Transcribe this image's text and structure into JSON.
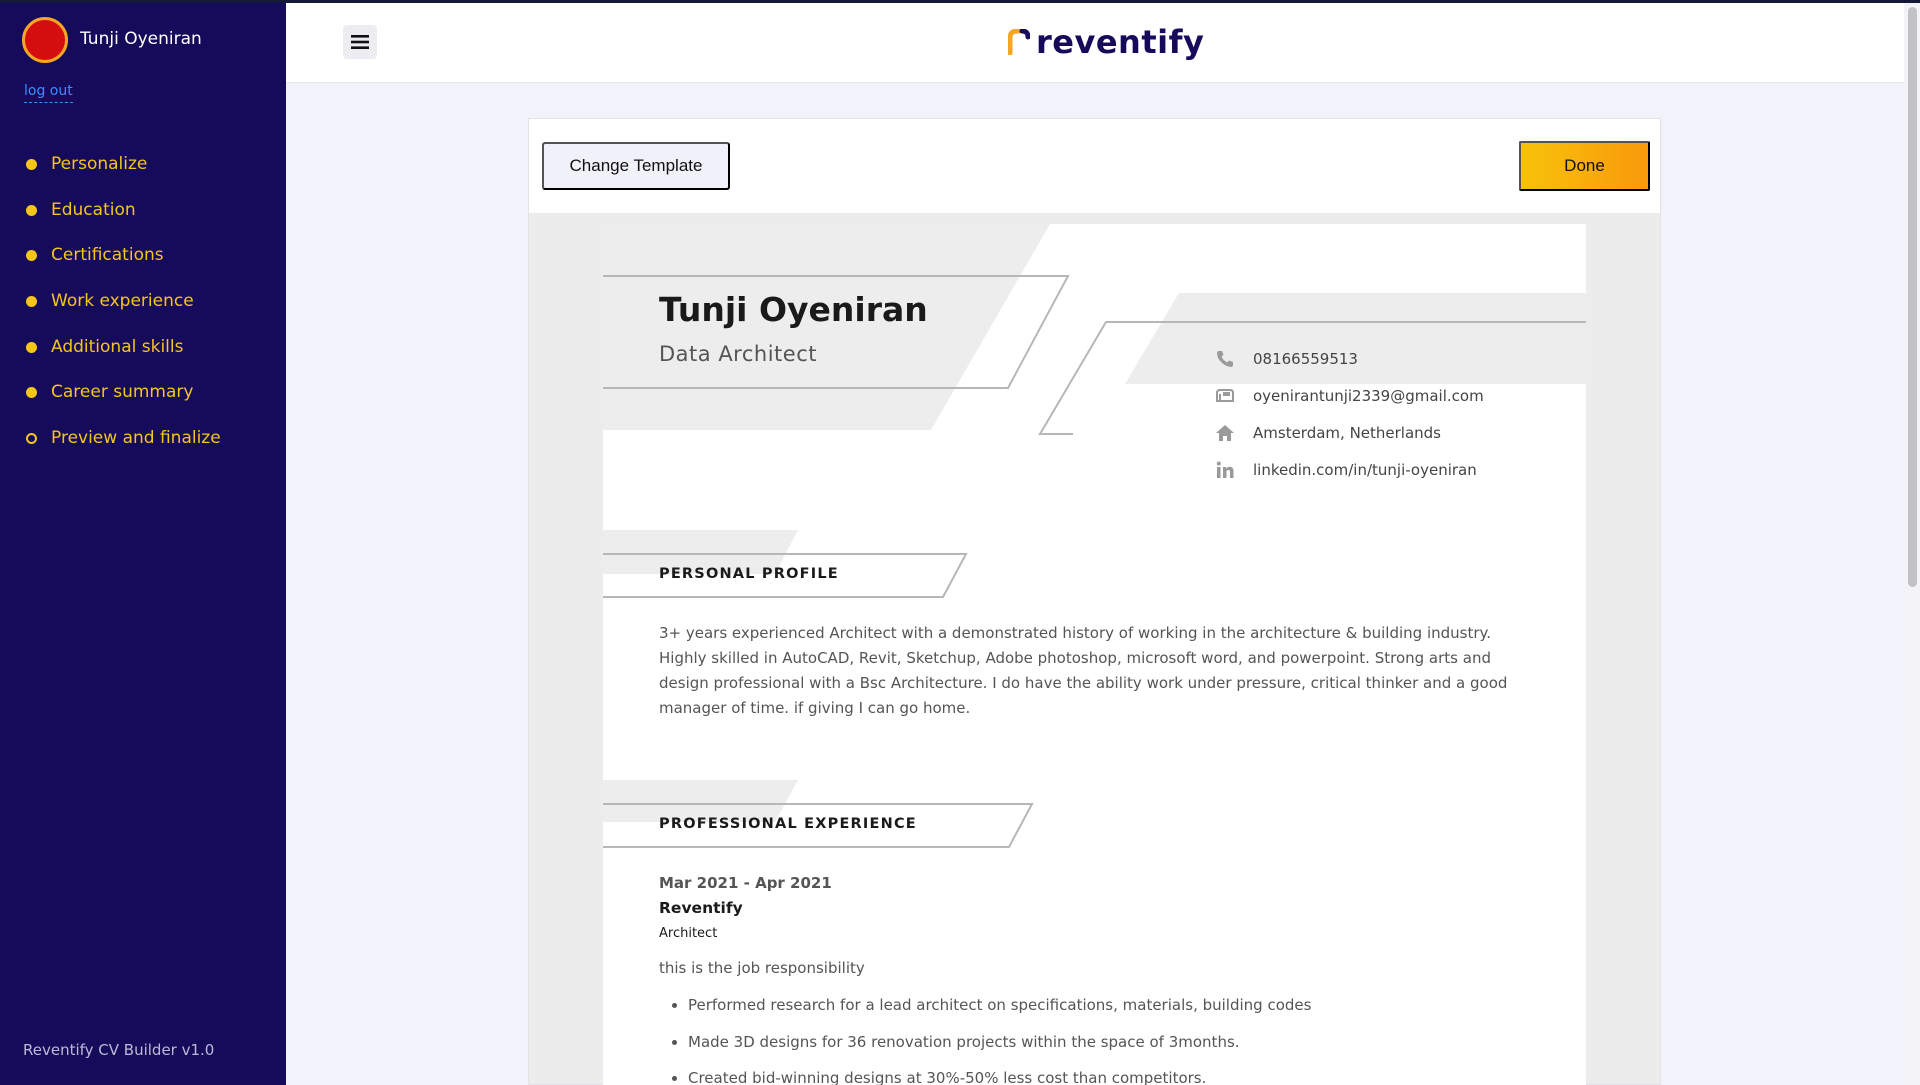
{
  "sidebar": {
    "username": "Tunji Oyeniran",
    "logout_label": "log out",
    "items": [
      {
        "label": "Personalize"
      },
      {
        "label": "Education"
      },
      {
        "label": "Certifications"
      },
      {
        "label": "Work experience"
      },
      {
        "label": "Additional skills"
      },
      {
        "label": "Career summary"
      },
      {
        "label": "Preview and finalize"
      }
    ],
    "footer": "Reventify CV Builder v1.0"
  },
  "header": {
    "logo_text": "reventify",
    "menu_icon": "hamburger-menu-icon"
  },
  "toolbar": {
    "change_template_label": "Change Template",
    "done_label": "Done"
  },
  "cv": {
    "name": "Tunji Oyeniran",
    "title": "Data Architect",
    "contact": {
      "phone": "08166559513",
      "email": "oyenirantunji2339@gmail.com",
      "location": "Amsterdam, Netherlands",
      "linkedin": "linkedin.com/in/tunji-oyeniran"
    },
    "profile_heading": "PERSONAL PROFILE",
    "profile_text": "3+ years experienced Architect with a demonstrated history of working in the architecture & building industry. Highly skilled in AutoCAD, Revit, Sketchup, Adobe photoshop, microsoft word, and powerpoint. Strong arts and design professional with a Bsc  Architecture. I do have the ability work under pressure, critical thinker and a good manager of time. if giving I can go home.",
    "experience_heading": "PROFESSIONAL EXPERIENCE",
    "experience": {
      "dates": "Mar 2021 - Apr 2021",
      "company": "Reventify",
      "role": "Architect",
      "description": "this is the job responsibility",
      "bullets": [
        "Performed research for a lead architect on specifications, materials, building codes",
        "Made 3D designs for 36 renovation projects within the space of 3months.",
        "Created bid-winning designs at 30%-50% less cost than competitors."
      ]
    }
  },
  "colors": {
    "sidebar_bg": "#150b5a",
    "nav_text": "#f5c518",
    "logout_link": "#3c8cff",
    "done_gradient_start": "#f7c20a",
    "done_gradient_end": "#f99a0b",
    "avatar": "#d40e0e"
  }
}
